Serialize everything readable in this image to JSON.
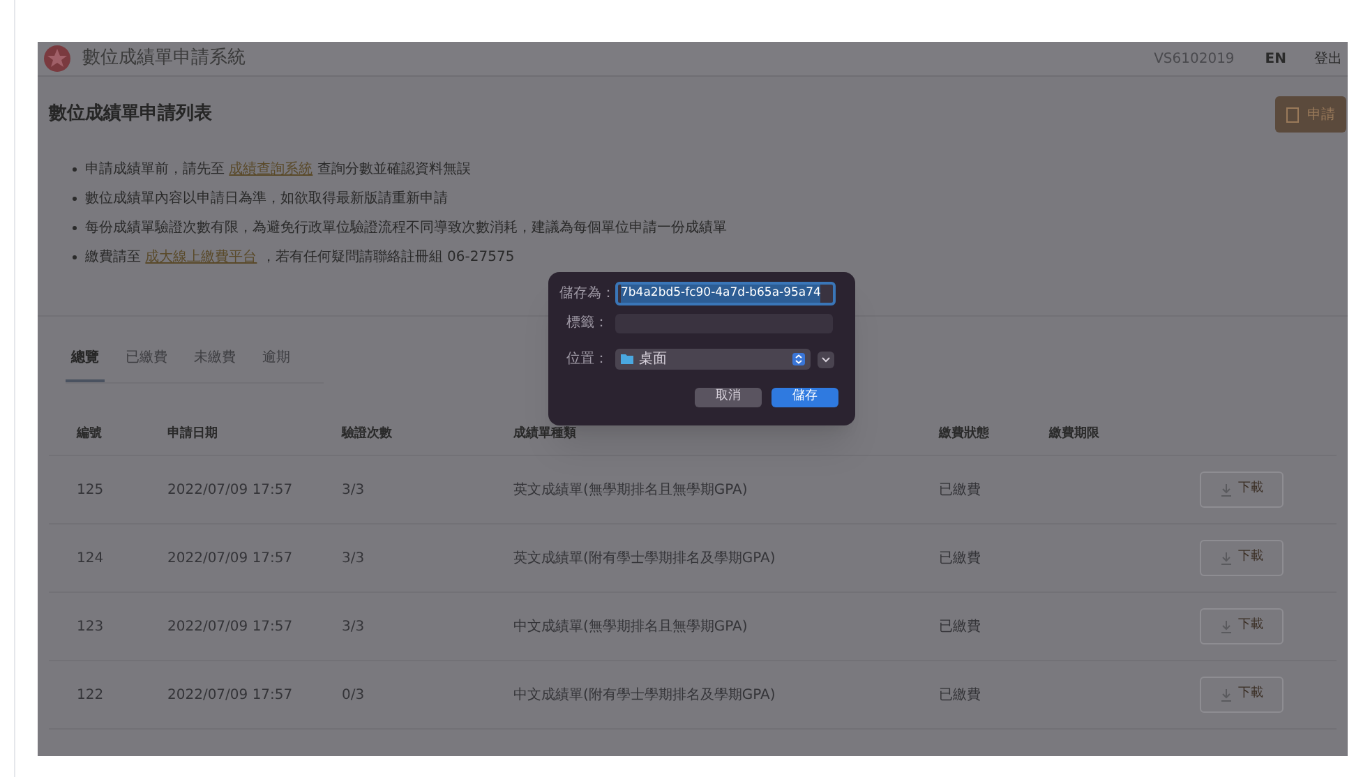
{
  "header": {
    "title": "數位成績單申請系統",
    "user_id": "VS6102019",
    "language": "EN",
    "logout": "登出"
  },
  "page_title": "數位成績單申請列表",
  "apply_button": "申請",
  "notices": [
    {
      "segments": [
        {
          "kind": "text",
          "text": "申請成績單前，請先至 "
        },
        {
          "kind": "link",
          "text": "成績查詢系統"
        },
        {
          "kind": "text",
          "text": " 查詢分數並確認資料無誤"
        }
      ]
    },
    {
      "segments": [
        {
          "kind": "text",
          "text": "數位成績單內容以申請日為準，如欲取得最新版請重新申請"
        }
      ]
    },
    {
      "segments": [
        {
          "kind": "text",
          "text": "每份成績單驗證次數有限，為避免行政單位驗證流程不同導致次數消耗，建議為每個單位申請一份成績單"
        }
      ]
    },
    {
      "segments": [
        {
          "kind": "text",
          "text": "繳費請至 "
        },
        {
          "kind": "link",
          "text": "成大線上繳費平台"
        },
        {
          "kind": "text",
          "text": " ，若有任何疑問請聯絡註冊組 06-27575"
        }
      ]
    }
  ],
  "tabs": [
    {
      "label": "總覽",
      "selected": true
    },
    {
      "label": "已繳費",
      "selected": false
    },
    {
      "label": "未繳費",
      "selected": false
    },
    {
      "label": "逾期",
      "selected": false
    }
  ],
  "table": {
    "columns": [
      "編號",
      "申請日期",
      "驗證次數",
      "成績單種類",
      "繳費狀態",
      "繳費期限"
    ],
    "rows": [
      {
        "cells": [
          "125",
          "2022/07/09 17:57",
          "3/3",
          "英文成績單(無學期排名且無學期GPA)",
          "已繳費",
          ""
        ],
        "action": "下載"
      },
      {
        "cells": [
          "124",
          "2022/07/09 17:57",
          "3/3",
          "英文成績單(附有學士學期排名及學期GPA)",
          "已繳費",
          ""
        ],
        "action": "下載"
      },
      {
        "cells": [
          "123",
          "2022/07/09 17:57",
          "3/3",
          "中文成績單(無學期排名且無學期GPA)",
          "已繳費",
          ""
        ],
        "action": "下載"
      },
      {
        "cells": [
          "122",
          "2022/07/09 17:57",
          "0/3",
          "中文成績單(附有學士學期排名及學期GPA)",
          "已繳費",
          ""
        ],
        "action": "下載"
      }
    ]
  },
  "dialog": {
    "save_as_label": "儲存為：",
    "save_as_value": "7b4a2bd5-fc90-4a7d-b65a-95a74",
    "tags_label": "標籤：",
    "location_label": "位置：",
    "location_value": "桌面",
    "cancel": "取消",
    "save": "儲存"
  }
}
